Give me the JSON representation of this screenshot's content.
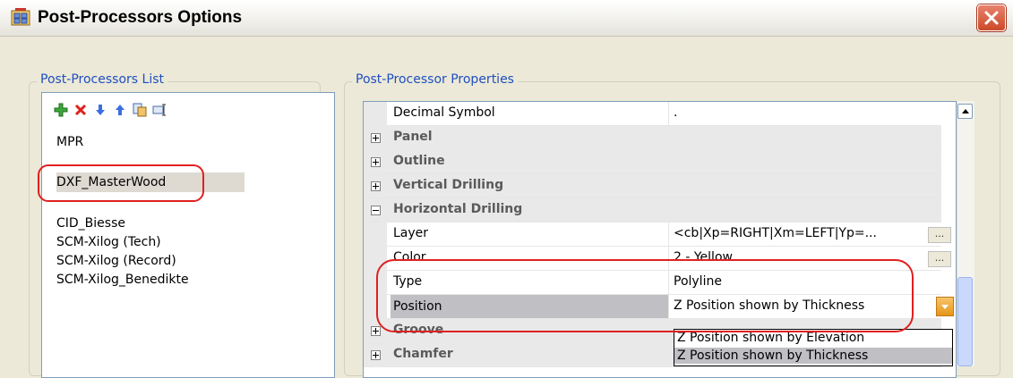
{
  "window": {
    "title": "Post-Processors Options"
  },
  "list_group": {
    "title": "Post-Processors List",
    "toolbar": [
      "add-icon",
      "delete-icon",
      "move-down-icon",
      "move-up-icon",
      "copy-icon",
      "rename-icon"
    ],
    "items": [
      "MPR",
      "DXF_MasterWood",
      "CID_Biesse",
      "SCM-Xilog (Tech)",
      "SCM-Xilog (Record)",
      "SCM-Xilog_Benedikte"
    ],
    "selected": "DXF_MasterWood"
  },
  "properties_group": {
    "title": "Post-Processor Properties",
    "rows": [
      {
        "name": "Decimal Symbol",
        "value": "."
      },
      {
        "category": "Panel",
        "expanded": false
      },
      {
        "category": "Outline",
        "expanded": false
      },
      {
        "category": "Vertical Drilling",
        "expanded": false
      },
      {
        "category": "Horizontal Drilling",
        "expanded": true
      },
      {
        "name": "Layer",
        "value": "<cb|Xp=RIGHT|Xm=LEFT|Yp=...",
        "has_button": true,
        "button_label": "..."
      },
      {
        "name": "Color",
        "value": "2 - Yellow",
        "has_button": true,
        "button_label": "..."
      },
      {
        "name": "Type",
        "value": "Polyline"
      },
      {
        "name": "Position",
        "value": "Z Position shown by Thickness",
        "selected": true
      },
      {
        "category": "Groove",
        "expanded": false
      },
      {
        "category": "Chamfer",
        "expanded": false
      }
    ],
    "dropdown_options": [
      "Z Position shown by Elevation",
      "Z Position shown by Thickness"
    ],
    "dropdown_selected": "Z Position shown by Thickness"
  },
  "colors": {
    "group_title": "#1f4fbf",
    "annotation": "#e02020",
    "selection": "#bfbfc4"
  }
}
